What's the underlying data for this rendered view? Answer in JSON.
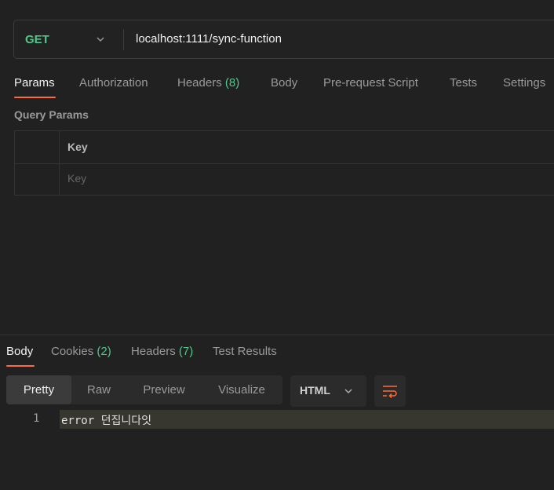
{
  "request": {
    "method": "GET",
    "url": "localhost:1111/sync-function"
  },
  "request_tabs": [
    {
      "label": "Params",
      "count": ""
    },
    {
      "label": "Authorization",
      "count": ""
    },
    {
      "label": "Headers",
      "count": "(8)"
    },
    {
      "label": "Body",
      "count": ""
    },
    {
      "label": "Pre-request Script",
      "count": ""
    },
    {
      "label": "Tests",
      "count": ""
    },
    {
      "label": "Settings",
      "count": ""
    }
  ],
  "query_params": {
    "title": "Query Params",
    "key_header": "Key",
    "key_placeholder": "Key"
  },
  "response_tabs": [
    {
      "label": "Body",
      "count": ""
    },
    {
      "label": "Cookies",
      "count": "(2)"
    },
    {
      "label": "Headers",
      "count": "(7)"
    },
    {
      "label": "Test Results",
      "count": ""
    }
  ],
  "view_modes": [
    "Pretty",
    "Raw",
    "Preview",
    "Visualize"
  ],
  "format": "HTML",
  "response_body": {
    "line_number": "1",
    "text": "error 던집니다잇"
  },
  "colors": {
    "accent": "#ff6c37",
    "method_get": "#4ec98a",
    "count": "#4ec98a"
  }
}
